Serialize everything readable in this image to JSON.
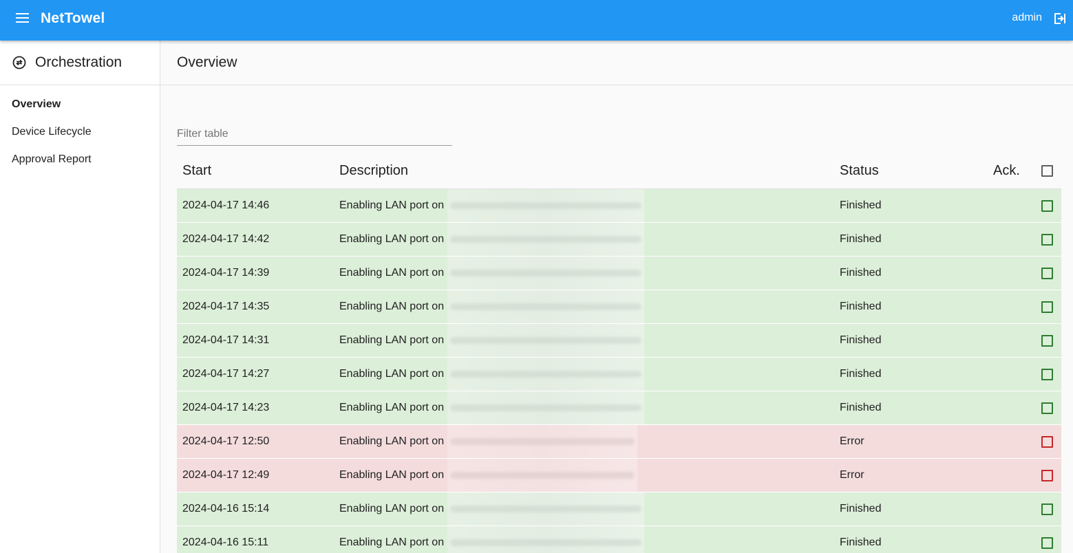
{
  "app": {
    "title": "NetTowel",
    "user": "admin"
  },
  "sidebar": {
    "title": "Orchestration",
    "items": [
      {
        "label": "Overview",
        "active": true
      },
      {
        "label": "Device Lifecycle",
        "active": false
      },
      {
        "label": "Approval Report",
        "active": false
      }
    ]
  },
  "main": {
    "title": "Overview",
    "filter": {
      "placeholder": "Filter table",
      "value": ""
    },
    "table": {
      "headers": {
        "start": "Start",
        "description": "Description",
        "status": "Status",
        "ack": "Ack."
      },
      "rows": [
        {
          "start": "2024-04-17 14:46",
          "description": "Enabling LAN port on",
          "status": "Finished"
        },
        {
          "start": "2024-04-17 14:42",
          "description": "Enabling LAN port on",
          "status": "Finished"
        },
        {
          "start": "2024-04-17 14:39",
          "description": "Enabling LAN port on",
          "status": "Finished"
        },
        {
          "start": "2024-04-17 14:35",
          "description": "Enabling LAN port on",
          "status": "Finished"
        },
        {
          "start": "2024-04-17 14:31",
          "description": "Enabling LAN port on",
          "status": "Finished"
        },
        {
          "start": "2024-04-17 14:27",
          "description": "Enabling LAN port on",
          "status": "Finished"
        },
        {
          "start": "2024-04-17 14:23",
          "description": "Enabling LAN port on",
          "status": "Finished"
        },
        {
          "start": "2024-04-17 12:50",
          "description": "Enabling LAN port on",
          "status": "Error"
        },
        {
          "start": "2024-04-17 12:49",
          "description": "Enabling LAN port on",
          "status": "Error"
        },
        {
          "start": "2024-04-16 15:14",
          "description": "Enabling LAN port on",
          "status": "Finished"
        },
        {
          "start": "2024-04-16 15:11",
          "description": "Enabling LAN port on",
          "status": "Finished"
        }
      ]
    }
  },
  "colors": {
    "accent": "#2196f3",
    "finished_bg": "#dcefd9",
    "error_bg": "#f4dcdd",
    "finished_check": "#2e7d32",
    "error_check": "#c62828"
  },
  "icons": {
    "menu": "menu-icon",
    "logout": "logout-icon",
    "orchestration": "sync-arrows-icon"
  }
}
